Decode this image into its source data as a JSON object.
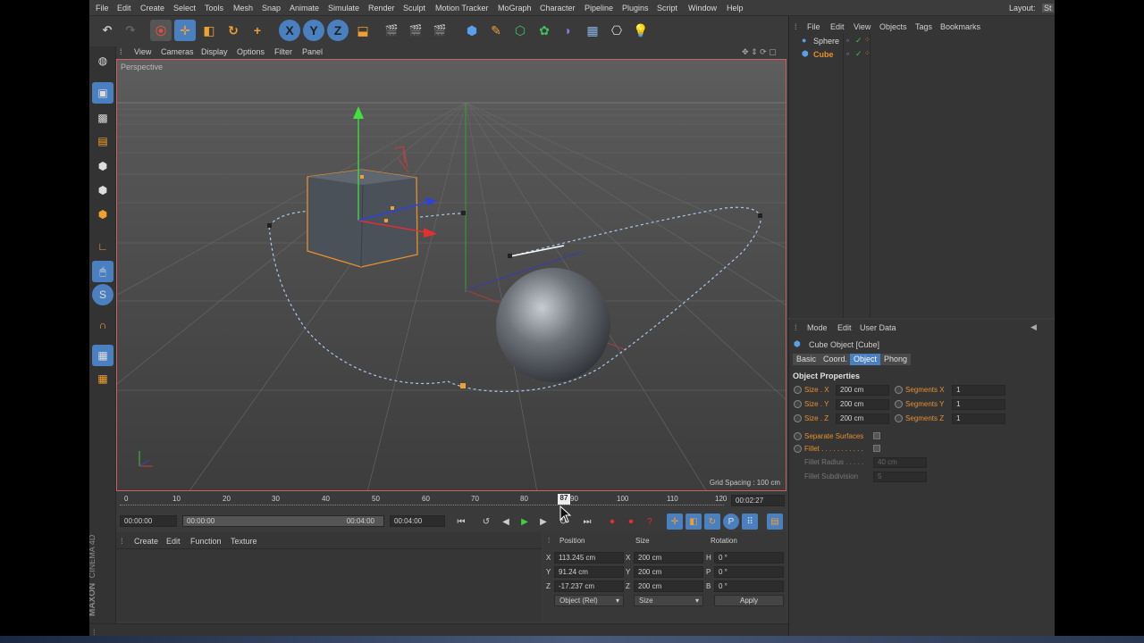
{
  "menubar": {
    "items": [
      "File",
      "Edit",
      "Create",
      "Select",
      "Tools",
      "Mesh",
      "Snap",
      "Animate",
      "Simulate",
      "Render",
      "Sculpt",
      "Motion Tracker",
      "MoGraph",
      "Character",
      "Pipeline",
      "Plugins",
      "Script",
      "Window",
      "Help"
    ],
    "layout_label": "Layout:",
    "layout_value": "St"
  },
  "toolbar": {
    "tools": [
      "undo-icon",
      "redo-icon",
      "live-selection-icon",
      "move-icon",
      "scale-icon",
      "rotate-icon",
      "add-icon",
      "x-axis-icon",
      "y-axis-icon",
      "z-axis-icon",
      "coordinate-system-icon",
      "render-view-icon",
      "render-picture-queue-icon",
      "render-settings-icon",
      "cube-primitive-icon",
      "pen-spline-icon",
      "subdivision-icon",
      "cloner-icon",
      "deformer-icon",
      "floor-icon",
      "camera-icon",
      "light-icon"
    ],
    "x_label": "X",
    "y_label": "Y",
    "z_label": "Z"
  },
  "viewport": {
    "menu": [
      "View",
      "Cameras",
      "Display",
      "Options",
      "Filter",
      "Panel"
    ],
    "label": "Perspective",
    "grid_spacing": "Grid Spacing : 100 cm"
  },
  "timeline": {
    "ticks": [
      "0",
      "10",
      "20",
      "30",
      "40",
      "50",
      "60",
      "70",
      "80",
      "90",
      "100",
      "110",
      "120"
    ],
    "current_frame": "87",
    "current_time": "00:02:27",
    "start_time": "00:00:00",
    "range_start": "00:00:00",
    "range_end": "00:04:00",
    "end_time": "00:04:00"
  },
  "material_manager": {
    "menu": [
      "Create",
      "Edit",
      "Function",
      "Texture"
    ],
    "logo_line1": "MAXON",
    "logo_line2": "CINEMA 4D"
  },
  "coordinates": {
    "headers": [
      "Position",
      "Size",
      "Rotation"
    ],
    "rows": [
      {
        "axis": "X",
        "position": "113.245 cm",
        "size_axis": "X",
        "size": "200 cm",
        "rot_axis": "H",
        "rotation": "0 °"
      },
      {
        "axis": "Y",
        "position": "91.24 cm",
        "size_axis": "Y",
        "size": "200 cm",
        "rot_axis": "P",
        "rotation": "0 °"
      },
      {
        "axis": "Z",
        "position": "-17.237 cm",
        "size_axis": "Z",
        "size": "200 cm",
        "rot_axis": "B",
        "rotation": "0 °"
      }
    ],
    "mode_select": "Object (Rel)",
    "size_select": "Size",
    "apply_label": "Apply"
  },
  "object_manager": {
    "menu": [
      "File",
      "Edit",
      "View",
      "Objects",
      "Tags",
      "Bookmarks"
    ],
    "objects": [
      {
        "name": "Sphere",
        "selected": false
      },
      {
        "name": "Cube",
        "selected": true
      }
    ]
  },
  "attribute_manager": {
    "menu": [
      "Mode",
      "Edit",
      "User Data"
    ],
    "title": "Cube Object [Cube]",
    "tabs": [
      "Basic",
      "Coord.",
      "Object",
      "Phong"
    ],
    "active_tab": "Object",
    "section": "Object Properties",
    "size_x_label": "Size . X",
    "size_x": "200 cm",
    "size_y_label": "Size . Y",
    "size_y": "200 cm",
    "size_z_label": "Size . Z",
    "size_z": "200 cm",
    "seg_x_label": "Segments X",
    "seg_x": "1",
    "seg_y_label": "Segments Y",
    "seg_y": "1",
    "seg_z_label": "Segments Z",
    "seg_z": "1",
    "separate_label": "Separate Surfaces",
    "fillet_label": "Fillet . . . . . . . . . . .",
    "fillet_radius_label": "Fillet Radius . . . . .",
    "fillet_radius": "40 cm",
    "fillet_sub_label": "Fillet Subdivision",
    "fillet_sub": "5"
  },
  "colors": {
    "accent": "#e8902a",
    "selection": "#4a7fc0",
    "viewport_border": "#d06060"
  }
}
